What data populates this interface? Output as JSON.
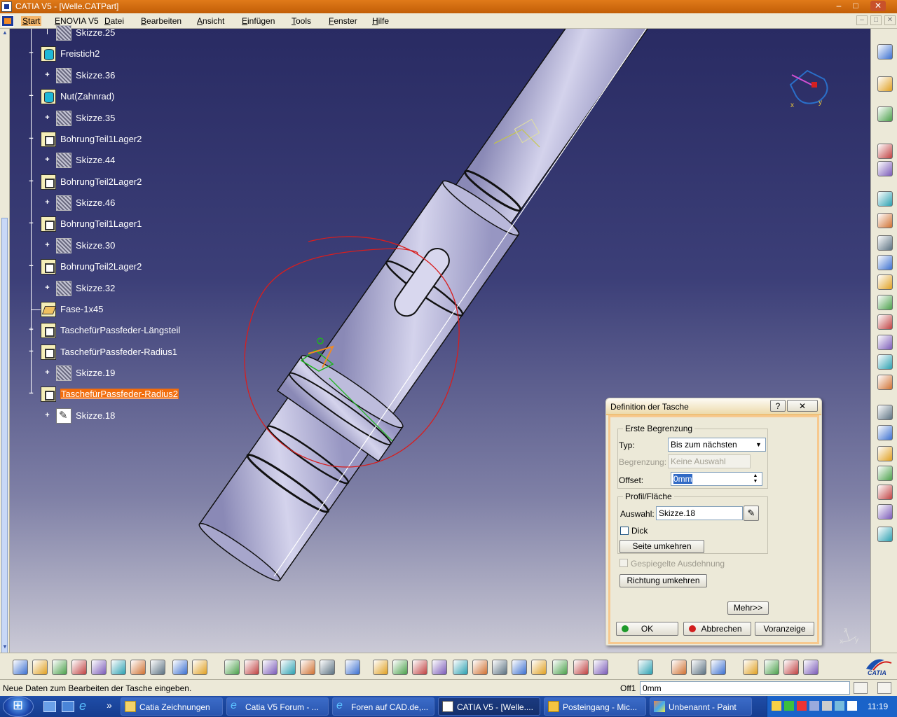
{
  "window": {
    "title": "CATIA V5 - [Welle.CATPart]",
    "controls": [
      "–",
      "□",
      "✕"
    ]
  },
  "menubar": {
    "items": [
      "Start",
      "ENOVIA V5",
      "Datei",
      "Bearbeiten",
      "Ansicht",
      "Einfügen",
      "Tools",
      "Fenster",
      "Hilfe"
    ],
    "active_item": "Start",
    "mdi_controls": [
      "–",
      "□",
      "✕"
    ]
  },
  "tree": {
    "items": [
      {
        "label": "Skizze.25",
        "type": "sketch"
      },
      {
        "label": "Freistich2",
        "type": "groove"
      },
      {
        "label": "Skizze.36",
        "type": "sketch"
      },
      {
        "label": "Nut(Zahnrad)",
        "type": "groove"
      },
      {
        "label": "Skizze.35",
        "type": "sketch"
      },
      {
        "label": "BohrungTeil1Lager2",
        "type": "pocket"
      },
      {
        "label": "Skizze.44",
        "type": "sketch"
      },
      {
        "label": "BohrungTeil2Lager2",
        "type": "pocket"
      },
      {
        "label": "Skizze.46",
        "type": "sketch"
      },
      {
        "label": "BohrungTeil1Lager1",
        "type": "pocket"
      },
      {
        "label": "Skizze.30",
        "type": "sketch"
      },
      {
        "label": "BohrungTeil2Lager2",
        "type": "pocket"
      },
      {
        "label": "Skizze.32",
        "type": "sketch"
      },
      {
        "label": "Fase-1x45",
        "type": "chamfer"
      },
      {
        "label": "TaschefürPassfeder-Längsteil",
        "type": "pocket"
      },
      {
        "label": "TaschefürPassfeder-Radius1",
        "type": "pocket"
      },
      {
        "label": "Skizze.19",
        "type": "sketch"
      },
      {
        "label": "TaschefürPassfeder-Radius2",
        "type": "pocket",
        "selected": true
      },
      {
        "label": "Skizze.18",
        "type": "sketch-edit"
      }
    ]
  },
  "compass": {
    "axis_labels": [
      "x",
      "y"
    ]
  },
  "axes_triad": {
    "labels": [
      "z",
      "x",
      "y"
    ]
  },
  "dialog": {
    "title": "Definition der Tasche",
    "help_button": "?",
    "close_button": "✕",
    "group_first_limit": "Erste Begrenzung",
    "type_label": "Typ:",
    "type_value": "Bis zum nächsten",
    "limit_label": "Begrenzung:",
    "limit_value": "Keine Auswahl",
    "offset_label": "Offset:",
    "offset_value": "0mm",
    "group_profile": "Profil/Fläche",
    "selection_label": "Auswahl:",
    "selection_value": "Skizze.18",
    "thick_label": "Dick",
    "reverse_side_button": "Seite umkehren",
    "mirrored_label": "Gespiegelte Ausdehnung",
    "reverse_direction_button": "Richtung umkehren",
    "more_button": "Mehr>>",
    "ok_button": "OK",
    "cancel_button": "Abbrechen",
    "preview_button": "Voranzeige"
  },
  "statusbar": {
    "message": "Neue Daten zum Bearbeiten der Tasche eingeben.",
    "command_label": "Off1",
    "command_value": "0mm"
  },
  "bottom_toolbar": {
    "icons": [
      "new-file-icon",
      "open-file-icon",
      "save-icon",
      "print-icon",
      "cut-icon",
      "copy-icon",
      "paste-icon",
      "undo-icon",
      "redo-icon",
      "whats-this-icon",
      "formula-icon",
      "comment-icon",
      "knowledge-icon",
      "table-icon",
      "catalog-icon",
      "measure-icon",
      "fly-icon",
      "fit-all-icon",
      "pan-icon",
      "rotate-icon",
      "zoom-in-icon",
      "zoom-out-icon",
      "normal-view-icon",
      "create-multiview-icon",
      "isometric-view-icon",
      "render-style-icon",
      "hide-show-icon",
      "swap-space-icon",
      "snap-icon",
      "analysis-icon",
      "mass-icon",
      "update-icon",
      "manipulate-icon",
      "axis-system-icon",
      "compass-icon",
      "dimension-icon",
      "grid-icon"
    ]
  },
  "right_toolbar": {
    "icons": [
      "select-arrow-icon",
      "sketcher-icon",
      "settings-icon",
      "reference-element-icon",
      "plane-icon",
      "pad-icon",
      "pocket-icon",
      "shaft-icon",
      "groove-icon",
      "hole-icon",
      "rib-icon",
      "slot-icon",
      "stiffener-icon",
      "multi-section-icon",
      "fillet-icon",
      "chamfer-icon",
      "draft-icon",
      "shell-icon",
      "thickness-icon",
      "thread-icon",
      "split-icon",
      "measure-item-icon",
      "part-body-icon"
    ]
  },
  "taskbar": {
    "buttons": [
      {
        "label": "Catia Zeichnungen",
        "icon": "folder-icon"
      },
      {
        "label": "Catia V5 Forum - ...",
        "icon": "ie-icon"
      },
      {
        "label": "Foren auf CAD.de,...",
        "icon": "ie-icon"
      },
      {
        "label": "CATIA V5 - [Welle....",
        "icon": "catia-icon",
        "active": true
      },
      {
        "label": "Posteingang - Mic...",
        "icon": "outlook-icon"
      },
      {
        "label": "Unbenannt - Paint",
        "icon": "paint-icon"
      }
    ],
    "overflow": "»",
    "clock": "11:19"
  },
  "brand": {
    "logo_text": "CATIA"
  },
  "colors": {
    "title_bar": "#d06a0e",
    "selection": "#f26d0c",
    "viewport_top": "#292b63",
    "viewport_bottom": "#cbcad6",
    "sketch_green": "#1fb51f",
    "annotation_red": "#d81e1e"
  }
}
